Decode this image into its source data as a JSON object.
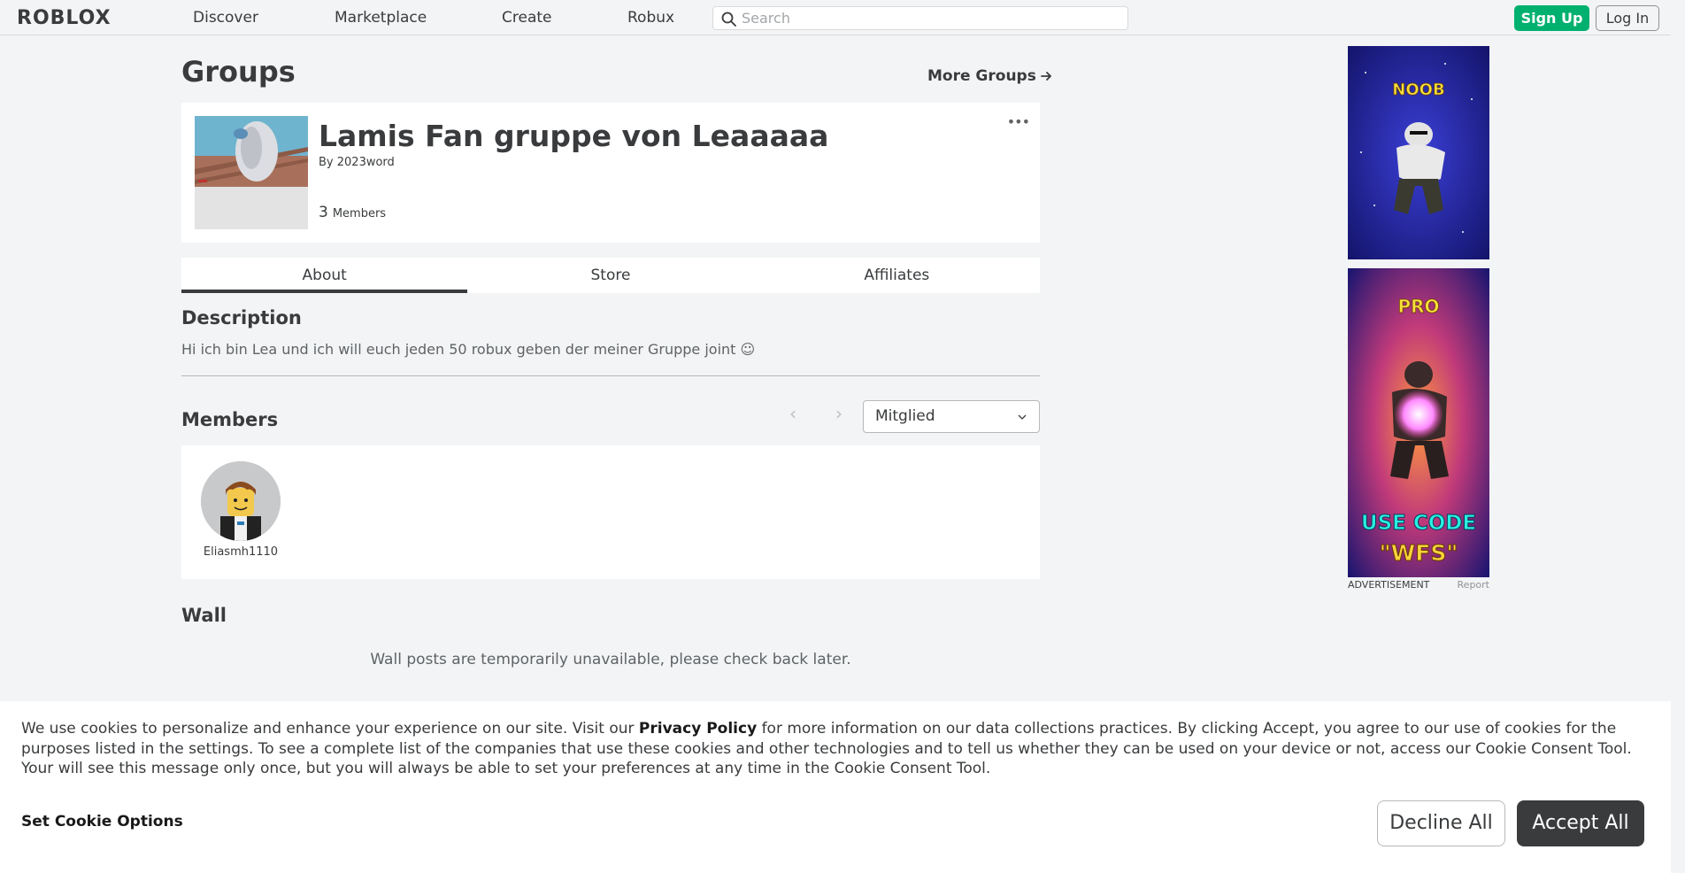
{
  "header": {
    "logo": "ROBLOX",
    "nav": [
      "Discover",
      "Marketplace",
      "Create",
      "Robux"
    ],
    "search_placeholder": "Search",
    "signup_label": "Sign Up",
    "login_label": "Log In"
  },
  "page": {
    "title": "Groups",
    "more_groups": "More Groups"
  },
  "group": {
    "name": "Lamis Fan gruppe von Leaaaaa",
    "owner_prefix": "By",
    "owner_name": "2023word",
    "member_count": "3",
    "member_label": "Members"
  },
  "tabs": [
    "About",
    "Store",
    "Affiliates"
  ],
  "description": {
    "title": "Description",
    "text": "Hi ich bin Lea und ich will euch jeden 50 robux geben der meiner Gruppe joint ☺"
  },
  "members": {
    "title": "Members",
    "role_select": "Mitglied",
    "list": [
      {
        "name": "Eliasmh1110"
      }
    ]
  },
  "wall": {
    "title": "Wall",
    "message": "Wall posts are temporarily unavailable, please check back later."
  },
  "ads": {
    "top_text": "NOOB",
    "bottom_title": "PRO",
    "bottom_code_1": "USE CODE",
    "bottom_code_2": "\"WFS\"",
    "label": "ADVERTISEMENT",
    "report": "Report"
  },
  "cookie": {
    "text_1": "We use cookies to personalize and enhance your experience on our site. Visit our ",
    "privacy_link": "Privacy Policy",
    "text_2": " for more information on our data collections practices. By clicking Accept, you agree to our use of cookies for the purposes listed in the settings. To see a complete list of the companies that use these cookies and other technologies and to tell us whether they can be used on your device or not, access our Cookie Consent Tool. Your will see this message only once, but you will always be able to set your preferences at any time in the Cookie Consent Tool.",
    "options_label": "Set Cookie Options",
    "decline_label": "Decline All",
    "accept_label": "Accept All"
  }
}
